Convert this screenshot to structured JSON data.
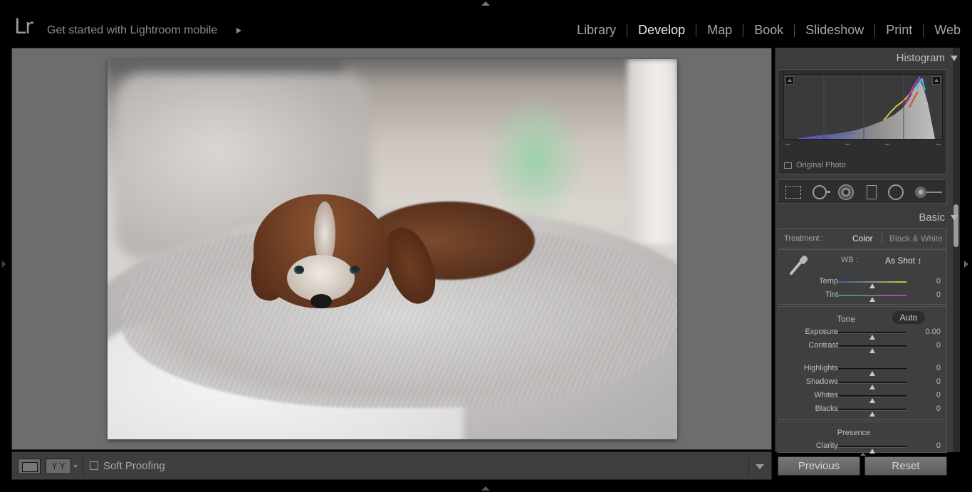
{
  "app": {
    "logo": "Lr",
    "mobile_promo": "Get started with Lightroom mobile"
  },
  "modules": [
    {
      "label": "Library",
      "active": false
    },
    {
      "label": "Develop",
      "active": true
    },
    {
      "label": "Map",
      "active": false
    },
    {
      "label": "Book",
      "active": false
    },
    {
      "label": "Slideshow",
      "active": false
    },
    {
      "label": "Print",
      "active": false
    },
    {
      "label": "Web",
      "active": false
    }
  ],
  "photo": {
    "subject": "puppy on blanket"
  },
  "histogram": {
    "title": "Histogram",
    "original_photo_label": "Original Photo"
  },
  "tools": [
    "crop-overlay-icon",
    "spot-removal-icon",
    "red-eye-icon",
    "graduated-filter-icon",
    "radial-filter-icon",
    "adjustment-brush-icon"
  ],
  "basic": {
    "title": "Basic",
    "treatment_label": "Treatment :",
    "treatment_color": "Color",
    "treatment_bw": "Black & White",
    "wb_label": "WB :",
    "wb_value": "As Shot ↕",
    "temp": {
      "label": "Temp",
      "value": "0",
      "level": 0.5
    },
    "tint": {
      "label": "Tint",
      "value": "0",
      "level": 0.5
    },
    "tone_label": "Tone",
    "auto_label": "Auto",
    "exposure": {
      "label": "Exposure",
      "value": "0.00",
      "level": 0.5
    },
    "contrast": {
      "label": "Contrast",
      "value": "0",
      "level": 0.5
    },
    "highlights": {
      "label": "Highlights",
      "value": "0",
      "level": 0.5
    },
    "shadows": {
      "label": "Shadows",
      "value": "0",
      "level": 0.5
    },
    "whites": {
      "label": "Whites",
      "value": "0",
      "level": 0.5
    },
    "blacks": {
      "label": "Blacks",
      "value": "0",
      "level": 0.5
    },
    "presence_label": "Presence",
    "clarity": {
      "label": "Clarity",
      "value": "0",
      "level": 0.5
    }
  },
  "toolbar": {
    "yy_label": "Y Y",
    "soft_proofing_label": "Soft Proofing"
  },
  "buttons": {
    "previous": "Previous",
    "reset": "Reset"
  }
}
